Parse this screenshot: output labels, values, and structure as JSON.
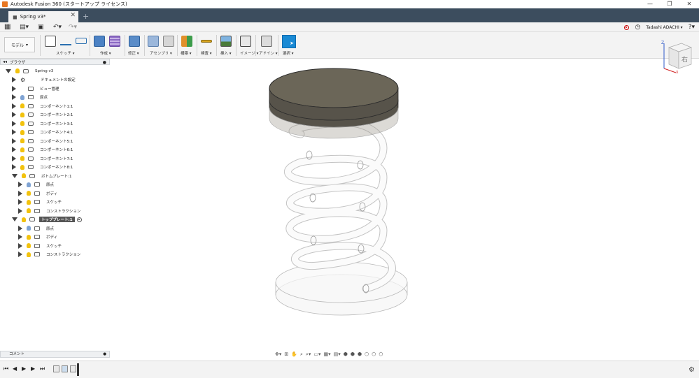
{
  "window": {
    "title": "Autodesk Fusion 360 (スタートアップ ライセンス)",
    "controls": [
      "—",
      "❐",
      "✕"
    ]
  },
  "tabs": {
    "doc_title": "Spring v3*",
    "new_tab": "+"
  },
  "appbar": {
    "user": "Tadashi ADACHI ▾",
    "grid_icon": "grid-icon",
    "file_icon": "file-icon",
    "save_icon": "save-icon",
    "undo_icon": "undo-icon",
    "redo_icon": "redo-icon"
  },
  "ribbon": {
    "workspace": "モデル",
    "groups": [
      {
        "label": "スケッチ ▾"
      },
      {
        "label": "作成 ▾"
      },
      {
        "label": "修正 ▾"
      },
      {
        "label": "アセンブリ ▾"
      },
      {
        "label": "構築 ▾"
      },
      {
        "label": "検査 ▾"
      },
      {
        "label": "挿入 ▾"
      },
      {
        "label": "イメージ ▾"
      },
      {
        "label": "アドイン ▾"
      },
      {
        "label": "選択 ▾"
      }
    ],
    "viewcube_face": "右"
  },
  "browser": {
    "header": "ブラウザ",
    "items": [
      {
        "label": "Spring v3",
        "indent": 0,
        "open": true,
        "bulb": "yellow",
        "icon": "doc"
      },
      {
        "label": "ドキュメントの設定",
        "indent": 1,
        "open": false,
        "bulb": "gear",
        "icon": "gear"
      },
      {
        "label": "ビュー管理",
        "indent": 1,
        "open": false,
        "bulb": "none",
        "icon": "folder"
      },
      {
        "label": "原点",
        "indent": 1,
        "open": false,
        "bulb": "blue",
        "icon": "folder"
      },
      {
        "label": "コンポーネント1:1",
        "indent": 1,
        "open": false,
        "bulb": "yellow",
        "icon": "comp"
      },
      {
        "label": "コンポーネント2:1",
        "indent": 1,
        "open": false,
        "bulb": "yellow",
        "icon": "comp"
      },
      {
        "label": "コンポーネント3:1",
        "indent": 1,
        "open": false,
        "bulb": "yellow",
        "icon": "comp"
      },
      {
        "label": "コンポーネント4:1",
        "indent": 1,
        "open": false,
        "bulb": "yellow",
        "icon": "comp"
      },
      {
        "label": "コンポーネント5:1",
        "indent": 1,
        "open": false,
        "bulb": "yellow",
        "icon": "comp"
      },
      {
        "label": "コンポーネント6:1",
        "indent": 1,
        "open": false,
        "bulb": "yellow",
        "icon": "comp"
      },
      {
        "label": "コンポーネント7:1",
        "indent": 1,
        "open": false,
        "bulb": "yellow",
        "icon": "comp"
      },
      {
        "label": "コンポーネント8:1",
        "indent": 1,
        "open": false,
        "bulb": "yellow",
        "icon": "comp"
      },
      {
        "label": "ボトムプレート:1",
        "indent": 1,
        "open": true,
        "bulb": "yellow",
        "icon": "comp"
      },
      {
        "label": "原点",
        "indent": 2,
        "open": false,
        "bulb": "blue",
        "icon": "folder"
      },
      {
        "label": "ボディ",
        "indent": 2,
        "open": false,
        "bulb": "yellow",
        "icon": "folder"
      },
      {
        "label": "スケッチ",
        "indent": 2,
        "open": false,
        "bulb": "yellow",
        "icon": "folder"
      },
      {
        "label": "コンストラクション",
        "indent": 2,
        "open": false,
        "bulb": "yellow",
        "icon": "folder"
      },
      {
        "label": "トッププレート:1",
        "indent": 1,
        "open": true,
        "bulb": "yellow",
        "icon": "comp",
        "active": true
      },
      {
        "label": "原点",
        "indent": 2,
        "open": false,
        "bulb": "blue",
        "icon": "folder"
      },
      {
        "label": "ボディ",
        "indent": 2,
        "open": false,
        "bulb": "yellow",
        "icon": "folder"
      },
      {
        "label": "スケッチ",
        "indent": 2,
        "open": false,
        "bulb": "yellow",
        "icon": "folder"
      },
      {
        "label": "コンストラクション",
        "indent": 2,
        "open": false,
        "bulb": "yellow",
        "icon": "folder"
      }
    ]
  },
  "comments": {
    "label": "コメント"
  },
  "colors": {
    "tabbar": "#3c4d5e",
    "plate_top": "#6b6658",
    "plate_side": "#57534a",
    "select_accent": "#1a8ad4"
  }
}
